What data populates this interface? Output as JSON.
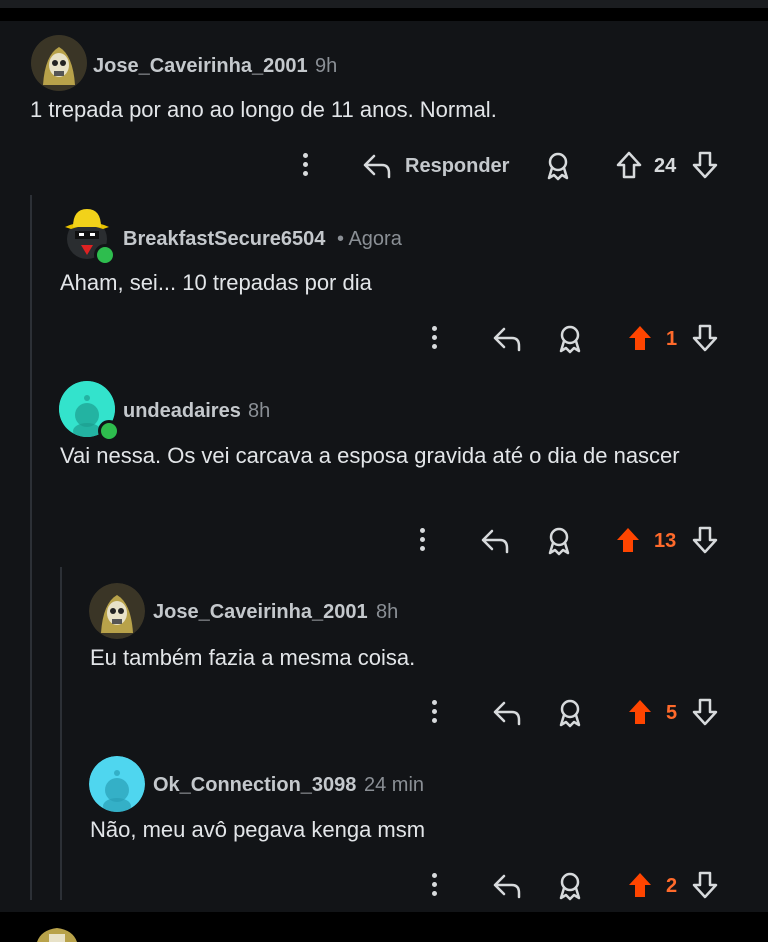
{
  "colors": {
    "accent_upvote": "#ff4500",
    "text": "#e2e5e8",
    "muted": "#8a8f95",
    "bg": "#121417"
  },
  "comments": [
    {
      "author": "Jose_Caveirinha_2001",
      "meta": "9h",
      "body": "1 trepada por ano ao longo de 11 anos. Normal.",
      "reply_label": "Responder",
      "score": "24",
      "upvoted": false,
      "avatar": "skull-avatar"
    },
    {
      "author": "BreakfastSecure6504",
      "meta": "• Agora",
      "body": "Aham, sei... 10 trepadas por dia",
      "score": "1",
      "upvoted": true,
      "avatar": "hat-avatar"
    },
    {
      "author": "undeadaires",
      "meta": "8h",
      "body": "Vai nessa. Os vei carcava a esposa gravida até o dia de nascer",
      "score": "13",
      "upvoted": true,
      "avatar": "snoo-avatar"
    },
    {
      "author": "Jose_Caveirinha_2001",
      "meta": "8h",
      "body": "Eu também fazia a mesma coisa.",
      "score": "5",
      "upvoted": true,
      "avatar": "skull-avatar"
    },
    {
      "author": "Ok_Connection_3098",
      "meta": "24 min",
      "body": "Não, meu avô pegava kenga msm",
      "score": "2",
      "upvoted": true,
      "avatar": "snoo-avatar"
    }
  ]
}
